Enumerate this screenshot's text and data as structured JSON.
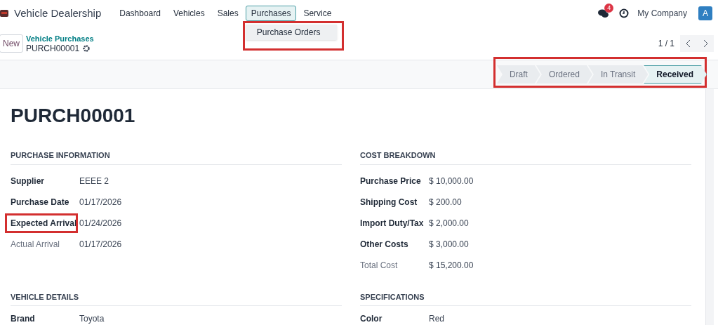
{
  "navbar": {
    "app_name": "Vehicle Dealership",
    "menu": [
      {
        "label": "Dashboard",
        "selected": false
      },
      {
        "label": "Vehicles",
        "selected": false
      },
      {
        "label": "Sales",
        "selected": false
      },
      {
        "label": "Purchases",
        "selected": true
      },
      {
        "label": "Service",
        "selected": false
      }
    ],
    "dropdown": [
      "Purchase Orders"
    ],
    "messages_badge": "4",
    "company": "My Company",
    "avatar": "A"
  },
  "control_panel": {
    "new_button": "New",
    "breadcrumb": "Vehicle Purchases",
    "record": "PURCH00001",
    "pager": "1 / 1"
  },
  "statusbar": [
    {
      "label": "Draft",
      "selected": false
    },
    {
      "label": "Ordered",
      "selected": false
    },
    {
      "label": "In Transit",
      "selected": false
    },
    {
      "label": "Received",
      "selected": true
    }
  ],
  "title": "PURCH00001",
  "groups": [
    {
      "title": "PURCHASE INFORMATION",
      "fields": [
        {
          "label": "Supplier",
          "value": "EEEE 2",
          "muted": false,
          "highlighted": false
        },
        {
          "label": "Purchase Date",
          "value": "01/17/2026",
          "muted": false,
          "highlighted": false
        },
        {
          "label": "Expected Arrival",
          "value": "01/24/2026",
          "muted": false,
          "highlighted": true
        },
        {
          "label": "Actual Arrival",
          "value": "01/17/2026",
          "muted": true,
          "highlighted": false
        }
      ]
    },
    {
      "title": "COST BREAKDOWN",
      "fields": [
        {
          "label": "Purchase Price",
          "value": "$ 10,000.00",
          "muted": false,
          "highlighted": false
        },
        {
          "label": "Shipping Cost",
          "value": "$ 200.00",
          "muted": false,
          "highlighted": false
        },
        {
          "label": "Import Duty/Tax",
          "value": "$ 2,000.00",
          "muted": false,
          "highlighted": false
        },
        {
          "label": "Other Costs",
          "value": "$ 3,000.00",
          "muted": false,
          "highlighted": false
        },
        {
          "label": "Total Cost",
          "value": "$ 15,200.00",
          "muted": true,
          "highlighted": false
        }
      ]
    },
    {
      "title": "VEHICLE DETAILS",
      "fields": [
        {
          "label": "Brand",
          "value": "Toyota",
          "muted": false,
          "highlighted": false
        }
      ]
    },
    {
      "title": "SPECIFICATIONS",
      "fields": [
        {
          "label": "Color",
          "value": "Red",
          "muted": false,
          "highlighted": false
        }
      ]
    }
  ]
}
